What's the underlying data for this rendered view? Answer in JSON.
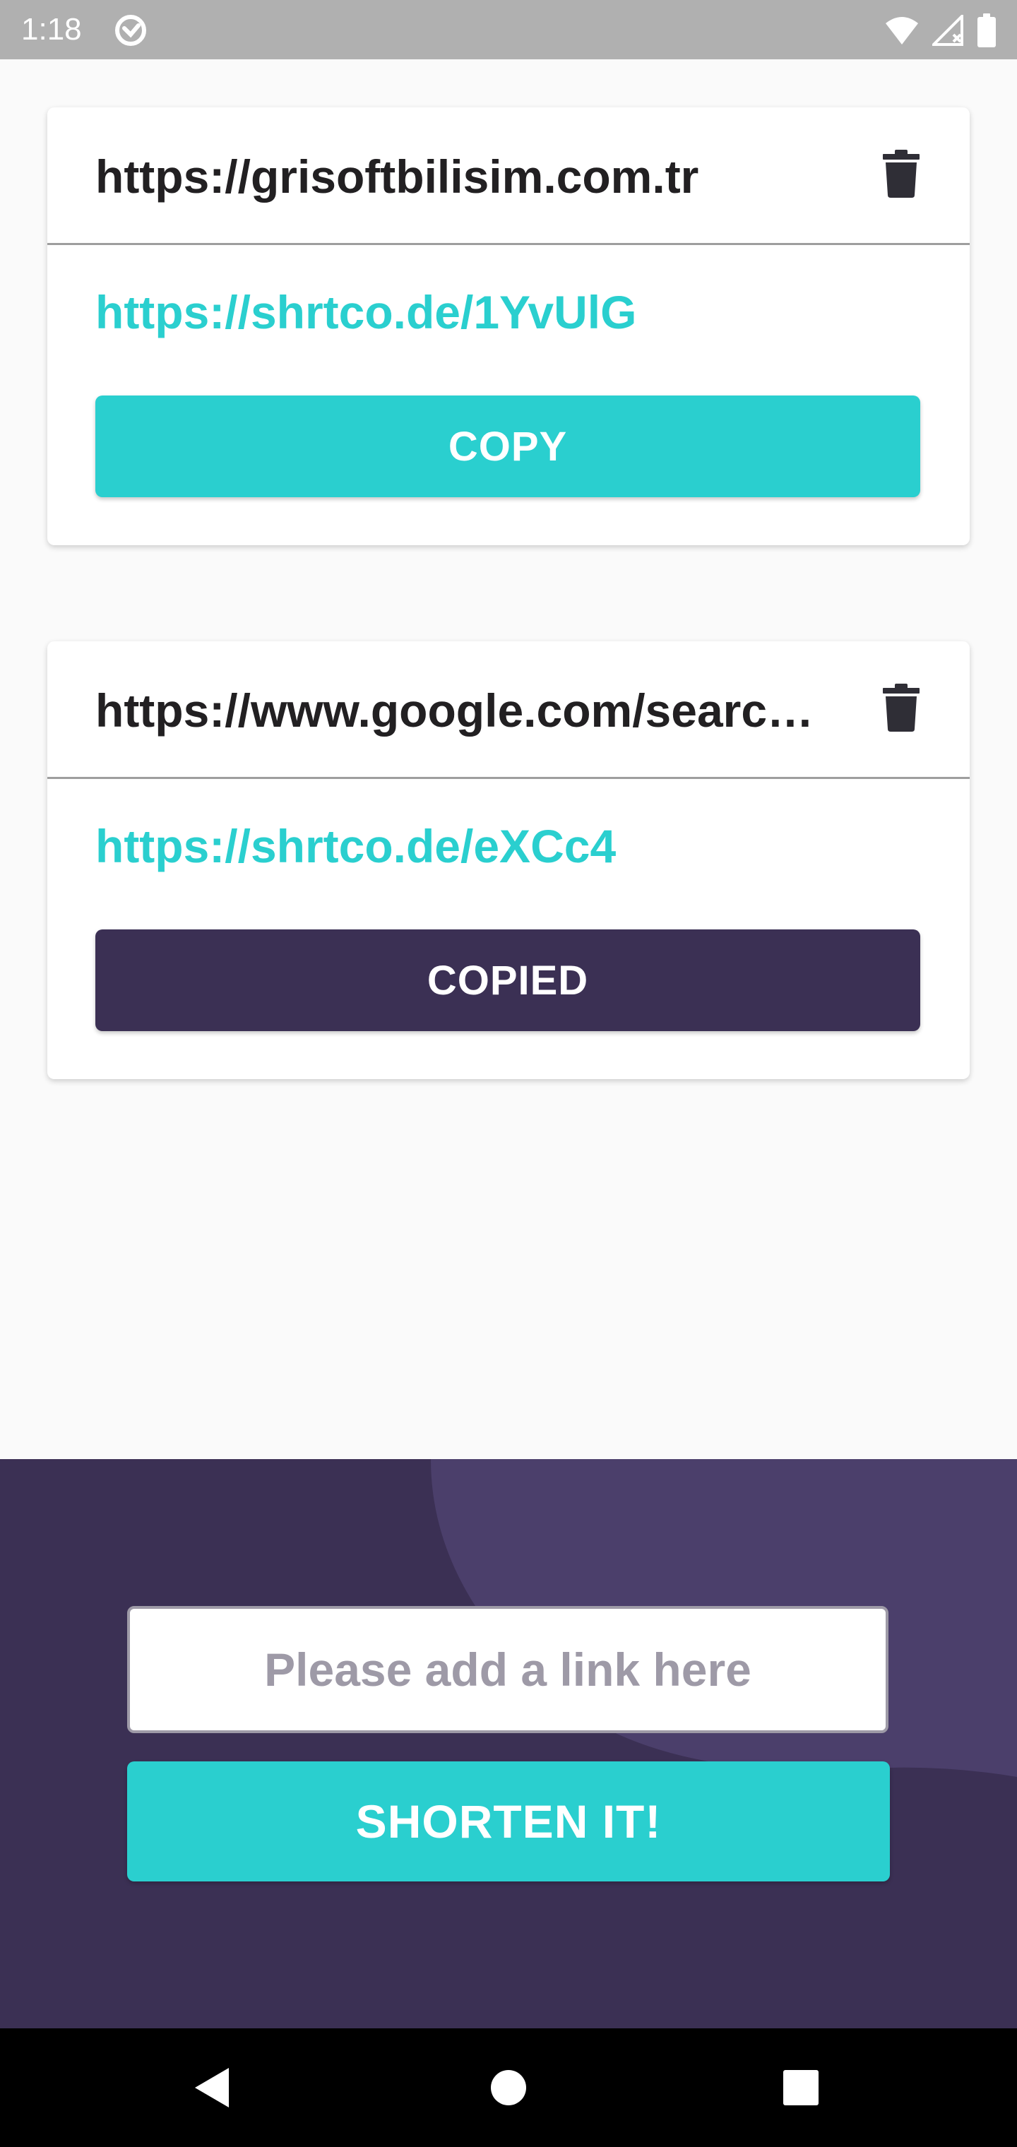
{
  "status_bar": {
    "time": "1:18",
    "icons": [
      "sync-icon",
      "wifi-icon",
      "cell-signal-icon",
      "battery-icon"
    ]
  },
  "links": [
    {
      "original": "https://grisoftbilisim.com.tr",
      "short": "https://shrtco.de/1YvUlG",
      "button_label": "COPY",
      "button_state": "idle"
    },
    {
      "original": "https://www.google.com/search?q=",
      "short": "https://shrtco.de/eXCc4",
      "button_label": "COPIED",
      "button_state": "copied"
    }
  ],
  "shorten": {
    "input_value": "",
    "input_placeholder": "Please add a link here",
    "button_label": "SHORTEN IT!"
  },
  "colors": {
    "accent": "#2ACFCF",
    "dark_violet": "#3B3054",
    "dark_text": "#222022",
    "delete_icon": "#2F2E36",
    "status_bar": "#B0B0B0",
    "background": "#FAFAFA"
  },
  "nav_bar": {
    "icons": [
      "back-icon",
      "home-icon",
      "recents-icon"
    ]
  }
}
